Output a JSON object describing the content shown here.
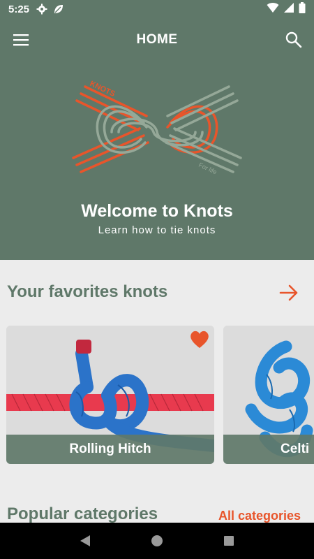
{
  "status_bar": {
    "time": "5:25",
    "icons": [
      "settings-icon",
      "leaf-icon",
      "wifi-icon",
      "signal-icon",
      "battery-icon"
    ]
  },
  "app_bar": {
    "title": "HOME",
    "menu_icon": "hamburger-menu-icon",
    "search_icon": "search-icon"
  },
  "hero": {
    "logo_text_top": "KNOTS",
    "logo_text_bottom": "For life",
    "welcome": "Welcome to Knots",
    "tagline": "Learn how to tie knots"
  },
  "favorites": {
    "title": "Your favorites knots",
    "arrow_icon": "arrow-right-icon",
    "cards": [
      {
        "label": "Rolling Hitch",
        "favorite": true
      },
      {
        "label": "Celti",
        "favorite": false
      }
    ]
  },
  "popular": {
    "title": "Popular categories",
    "link": "All categories"
  },
  "nav_bar": {
    "icons": [
      "back-icon",
      "home-icon",
      "recents-icon"
    ]
  },
  "colors": {
    "primary": "#5f7869",
    "accent": "#e8552b",
    "background": "#ececec"
  }
}
